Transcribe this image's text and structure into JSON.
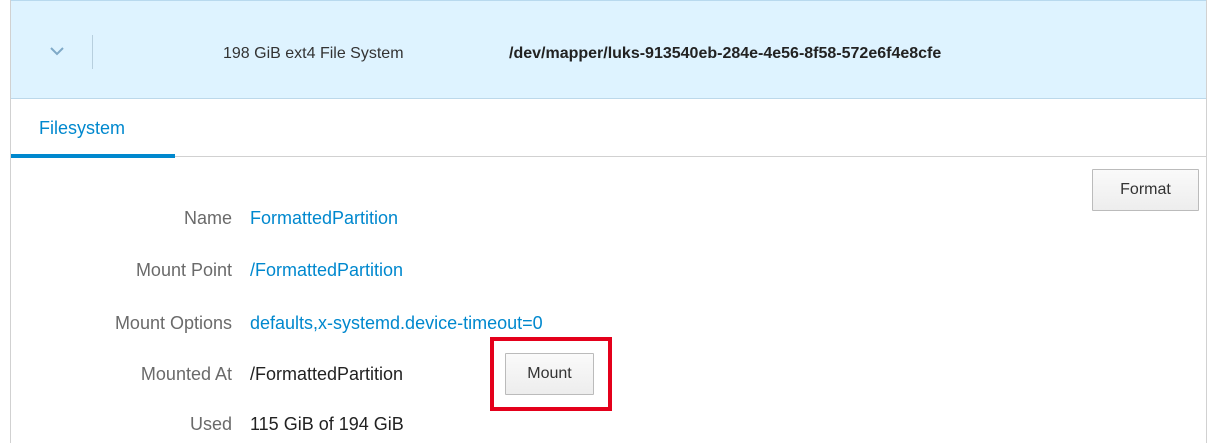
{
  "header": {
    "toggle_icon": "chevron-down-icon",
    "description": "198 GiB ext4 File System",
    "device": "/dev/mapper/luks-913540eb-284e-4e56-8f58-572e6f4e8cfe"
  },
  "tabs": [
    {
      "label": "Filesystem",
      "active": true
    }
  ],
  "actions": {
    "format_label": "Format",
    "mount_label": "Mount"
  },
  "properties": {
    "name": {
      "label": "Name",
      "value": "FormattedPartition"
    },
    "mount_point": {
      "label": "Mount Point",
      "value": "/FormattedPartition"
    },
    "mount_options": {
      "label": "Mount Options",
      "value": "defaults,x-systemd.device-timeout=0"
    },
    "mounted_at": {
      "label": "Mounted At",
      "value": "/FormattedPartition"
    },
    "used": {
      "label": "Used",
      "value": "115 GiB of 194 GiB"
    }
  },
  "colors": {
    "accent": "#0088ce",
    "header_bg": "#def3ff",
    "highlight": "#e4001b"
  }
}
